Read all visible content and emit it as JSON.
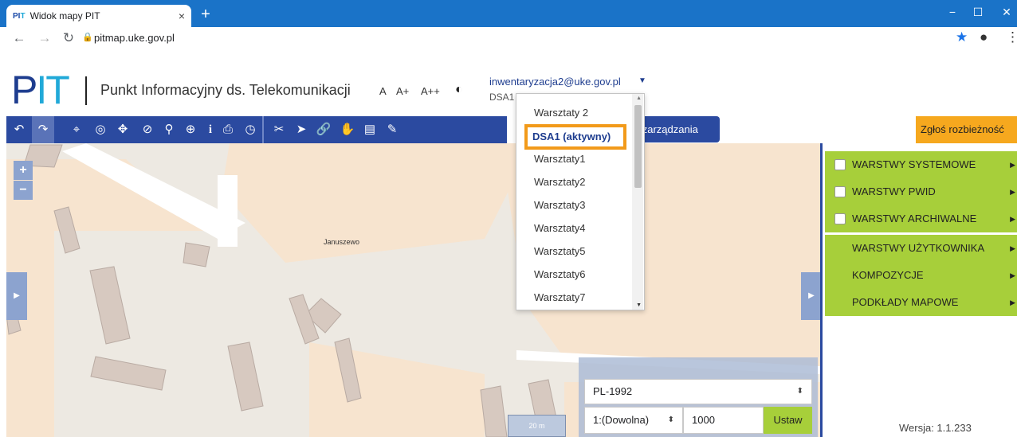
{
  "browser": {
    "tab_title": "Widok mapy PIT",
    "favicon_text_a": "PI",
    "favicon_text_b": "T",
    "tab_close": "×",
    "new_tab": "+",
    "url": "pitmap.uke.gov.pl",
    "min": "−",
    "max": "☐",
    "close": "✕"
  },
  "header": {
    "logo_p": "P",
    "logo_it": "IT",
    "title": "Punkt Informacyjny ds. Telekomunikacji",
    "font_small": "A",
    "font_medium": "A+",
    "font_large": "A++",
    "user_email": "inwentaryzacja2@uke.gov.pl",
    "workspace_label": "DSA1"
  },
  "toolbar": {
    "panel_button": "el zarządzania",
    "report_button": "Zgłoś rozbieżność"
  },
  "workspace_dropdown": {
    "items": [
      "Warsztaty 2",
      "Warsztaty1",
      "Warsztaty2",
      "Warsztaty3",
      "Warsztaty4",
      "Warsztaty5",
      "Warsztaty6",
      "Warsztaty7"
    ],
    "active": "DSA1 (aktywny)"
  },
  "map": {
    "zoom_in": "+",
    "zoom_out": "−",
    "place_label": "Januszewo",
    "scale_bar": "20 m",
    "crs": "PL-1992",
    "scale_mode": "1:(Dowolna)",
    "scale_value": "1000",
    "set_button": "Ustaw"
  },
  "layers": [
    {
      "label": "WARSTWY SYSTEMOWE",
      "checkbox": true
    },
    {
      "label": "WARSTWY PWID",
      "checkbox": true
    },
    {
      "label": "WARSTWY ARCHIWALNE",
      "checkbox": true
    },
    {
      "label": "WARSTWY UŻYTKOWNIKA",
      "checkbox": false
    },
    {
      "label": "KOMPOZYCJE",
      "checkbox": false
    },
    {
      "label": "PODKŁADY MAPOWE",
      "checkbox": false
    }
  ],
  "version": "Wersja: 1.1.233",
  "colors": {
    "brand_blue": "#2b4aa0",
    "layer_green": "#a7cf3a",
    "report_orange": "#f6a81e",
    "highlight_orange": "#f29a1a"
  }
}
